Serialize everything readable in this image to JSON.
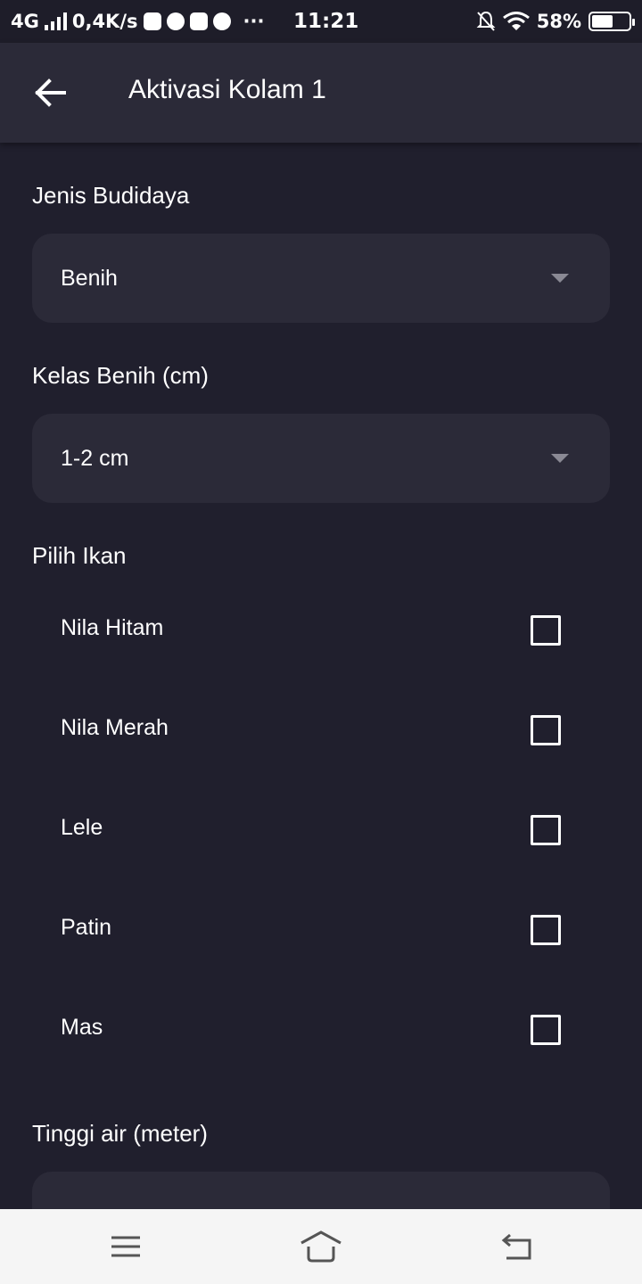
{
  "status_bar": {
    "network": "4G",
    "speed": "0,4K/s",
    "more": "···",
    "time": "11:21",
    "battery": "58%",
    "battery_level": 0.58
  },
  "app_bar": {
    "title": "Aktivasi Kolam 1",
    "back_icon": "arrow-left-icon"
  },
  "form": {
    "jenis_budidaya": {
      "label": "Jenis Budidaya",
      "value": "Benih"
    },
    "kelas_benih": {
      "label": "Kelas Benih (cm)",
      "value": "1-2 cm"
    },
    "pilih_ikan": {
      "label": "Pilih Ikan",
      "items": [
        {
          "name": "Nila Hitam",
          "checked": false
        },
        {
          "name": "Nila Merah",
          "checked": false
        },
        {
          "name": "Lele",
          "checked": false
        },
        {
          "name": "Patin",
          "checked": false
        },
        {
          "name": "Mas",
          "checked": false
        }
      ]
    },
    "tinggi_air": {
      "label": "Tinggi air (meter)"
    }
  },
  "colors": {
    "background": "#201f2d",
    "surface": "#2b2a38",
    "text": "#ffffff",
    "nav_bar": "#f5f5f5"
  }
}
